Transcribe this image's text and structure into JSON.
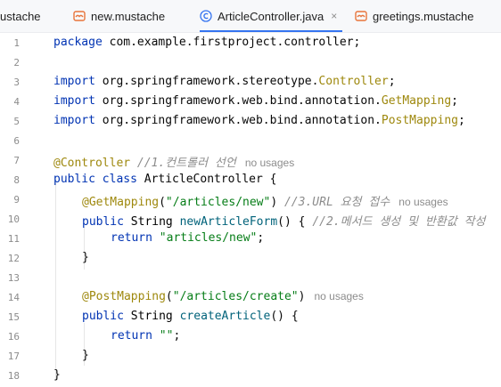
{
  "tabs": [
    {
      "label": "ustache",
      "icon": "mustache-icon",
      "active": false
    },
    {
      "label": "new.mustache",
      "icon": "mustache-icon",
      "active": false
    },
    {
      "label": "ArticleController.java",
      "icon": "class-icon",
      "active": true,
      "close": "×"
    },
    {
      "label": "greetings.mustache",
      "icon": "mustache-icon",
      "active": false
    }
  ],
  "line_numbers": [
    "1",
    "2",
    "3",
    "4",
    "5",
    "6",
    "7",
    "8",
    "9",
    "10",
    "11",
    "12",
    "13",
    "14",
    "15",
    "16",
    "17",
    "18"
  ],
  "code": {
    "l1_kw": "package",
    "l1_rest": " com.example.firstproject.controller;",
    "l3_kw": "import",
    "l3_pkg": " org.springframework.stereotype.",
    "l3_cls": "Controller",
    "l3_end": ";",
    "l4_kw": "import",
    "l4_pkg": " org.springframework.web.bind.annotation.",
    "l4_cls": "GetMapping",
    "l4_end": ";",
    "l5_kw": "import",
    "l5_pkg": " org.springframework.web.bind.annotation.",
    "l5_cls": "PostMapping",
    "l5_end": ";",
    "l7_ann": "@Controller",
    "l7_cmt": " //1.컨트롤러 선언",
    "l7_hint": "no usages",
    "l8_kw": "public class",
    "l8_rest": " ArticleController {",
    "l9_ann": "@GetMapping",
    "l9_open": "(",
    "l9_str": "\"/articles/new\"",
    "l9_close": ")",
    "l9_cmt": " //3.URL 요청 접수",
    "l9_hint": "no usages",
    "l10_kw": "public",
    "l10_typ": " String ",
    "l10_fn": "newArticleForm",
    "l10_rest": "() { ",
    "l10_cmt": "//2.메서드 생성 및 반환값 작성",
    "l11_kw": "return",
    "l11_str": " \"articles/new\"",
    "l11_end": ";",
    "l12": "}",
    "l14_ann": "@PostMapping",
    "l14_open": "(",
    "l14_str": "\"/articles/create\"",
    "l14_close": ")",
    "l14_hint": "no usages",
    "l15_kw": "public",
    "l15_typ": " String ",
    "l15_fn": "createArticle",
    "l15_rest": "() {",
    "l16_kw": "return",
    "l16_str": " \"\"",
    "l16_end": ";",
    "l17": "}",
    "l18": "}"
  },
  "colors": {
    "keyword": "#0033b3",
    "annotation": "#9e880d",
    "string": "#067d17",
    "comment": "#8c8c8c",
    "accent_tab": "#3574f0",
    "mustache_icon": "#e8743b"
  }
}
